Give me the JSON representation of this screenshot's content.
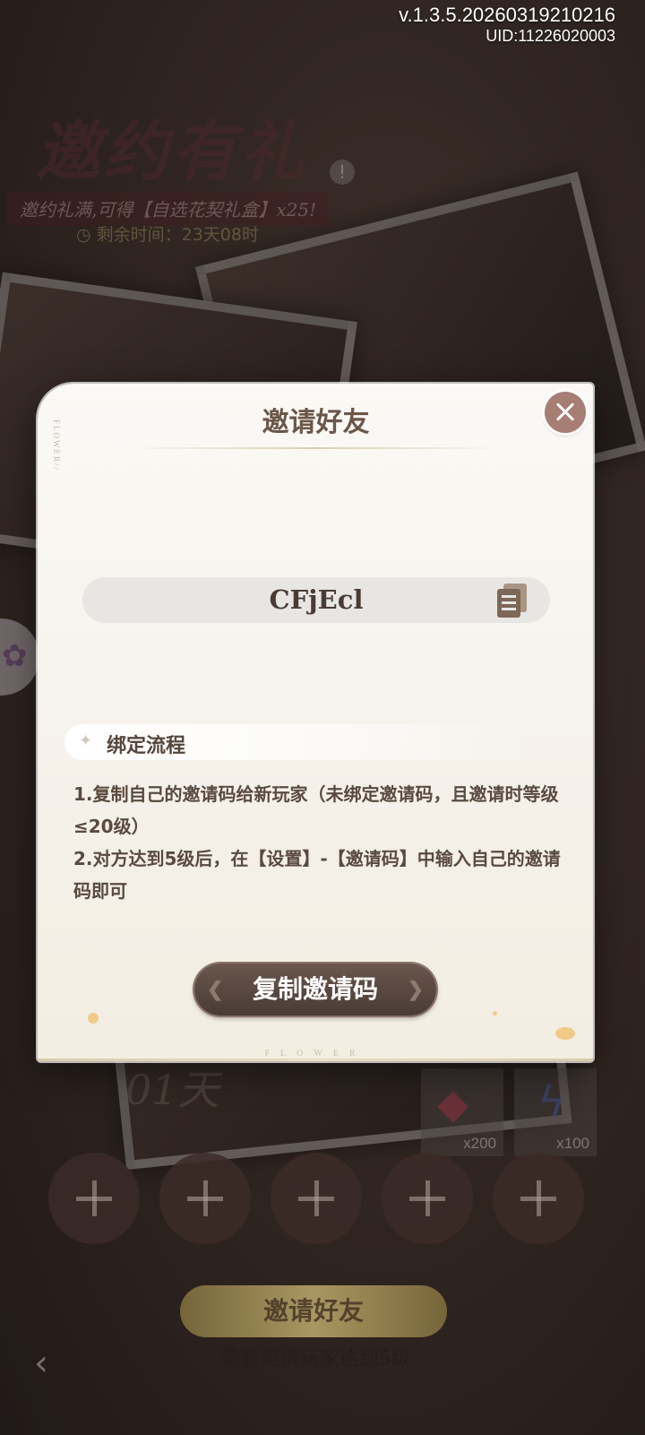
{
  "app": {
    "version": "v.1.3.5.20260319210216",
    "uid": "UID:11226020003"
  },
  "event": {
    "title": "邀约有礼",
    "subtitle": "邀约礼满,可得【自选花契礼盒】x25!",
    "timer": "剩余时间：23天08时"
  },
  "background": {
    "day_badge": "01",
    "rewards": [
      {
        "icon": "ruby-gem-icon",
        "qty": "x200"
      },
      {
        "icon": "lightning-energy-icon",
        "qty": "x100"
      }
    ],
    "invite_button": "邀请好友",
    "invite_hint": "需要邀请玩家达到5级"
  },
  "modal": {
    "title": "邀请好友",
    "flower_tag": "FLOWER//",
    "invite_code": "CFjEcl",
    "section_title": "绑定流程",
    "rules": [
      "1.复制自己的邀请码给新玩家（未绑定邀请码，且邀请时等级≤20级）",
      " 2.对方达到5级后，在【设置】-【邀请码】中输入自己的邀请码即可"
    ],
    "copy_button": "复制邀请码",
    "footer_word": "FLOWER"
  },
  "colors": {
    "modal_bg": "#fbf9f5",
    "title_text": "#6b5648",
    "close_button": "#a67e74",
    "primary_button": "#4a3b34"
  }
}
